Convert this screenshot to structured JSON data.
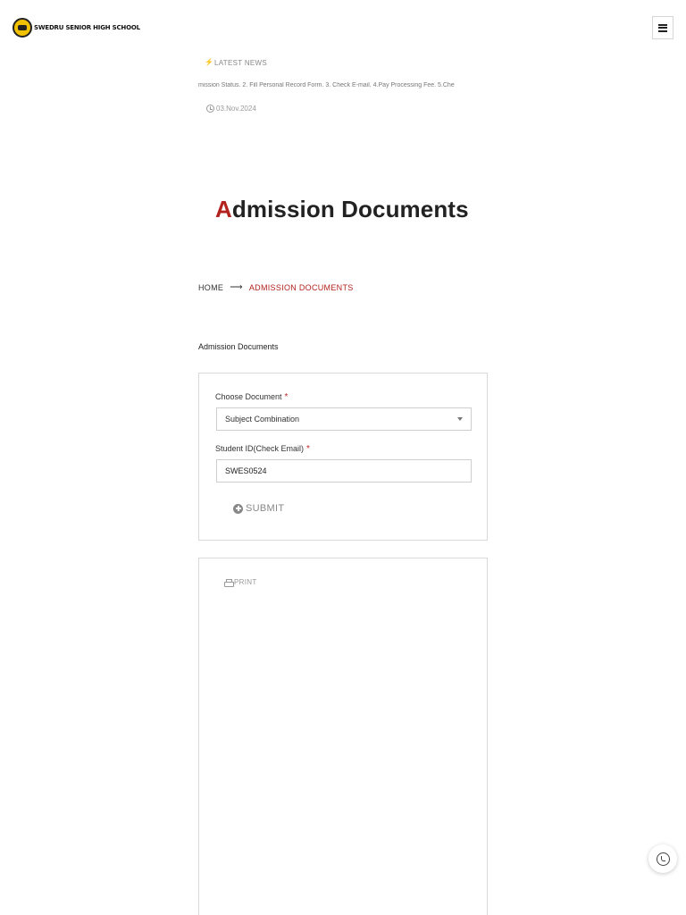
{
  "header": {
    "logo_text": "SWEDRU SENIOR HIGH SCHOOL",
    "menu_icon": "hamburger-menu-icon"
  },
  "news": {
    "label": "LATEST NEWS",
    "ticker": "mission Status. 2. Fill Personal Record Form. 3. Check E-mail. 4.Pay Processing Fee. 5.Che",
    "date": "03.Nov.2024"
  },
  "page": {
    "title_first": "A",
    "title_rest": "dmission Documents"
  },
  "breadcrumb": {
    "home": "HOME",
    "arrow": "⟶",
    "current": "ADMISSION DOCUMENTS"
  },
  "section_label": "Admission Documents",
  "form": {
    "choose_document_label": "Choose Document",
    "choose_document_value": "Subject Combination",
    "student_id_label": "Student ID(Check Email)",
    "student_id_value": "SWES0524",
    "required_mark": "*",
    "submit_label": "SUBMIT"
  },
  "print": {
    "label": "PRINT"
  },
  "colors": {
    "accent": "#b3231e",
    "required": "#c62828",
    "muted": "#888888",
    "border": "#d9d9d9"
  }
}
